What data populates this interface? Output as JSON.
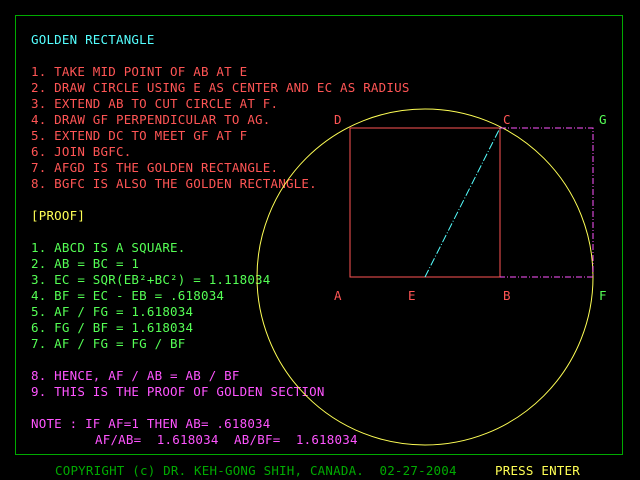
{
  "title": "GOLDEN RECTANGLE",
  "steps": [
    "1. TAKE MID POINT OF AB AT E",
    "2. DRAW CIRCLE USING E AS CENTER AND EC AS RADIUS",
    "3. EXTEND AB TO CUT CIRCLE AT F.",
    "4. DRAW GF PERPENDICULAR TO AG.",
    "5. EXTEND DC TO MEET GF AT F",
    "6. JOIN BGFC.",
    "7. AFGD IS THE GOLDEN RECTANGLE.",
    "8. BGFC IS ALSO THE GOLDEN RECTANGLE."
  ],
  "proof_heading": "[PROOF]",
  "proof_lines": [
    "1. ABCD IS A SQUARE.",
    "2. AB = BC = 1",
    "3. EC = SQR(EB²+BC²) = 1.118034",
    "4. BF = EC - EB = .618034",
    "5. AF / FG = 1.618034",
    "6. FG / BF = 1.618034",
    "7. AF / FG = FG / BF"
  ],
  "conclusion_lines": [
    "8. HENCE, AF / AB = AB / BF",
    "9. THIS IS THE PROOF OF GOLDEN SECTION"
  ],
  "note_line1": "NOTE : IF AF=1 THEN AB= .618034",
  "note_line2": "AF/AB=  1.618034  AB/BF=  1.618034",
  "points": {
    "A": "A",
    "E": "E",
    "B": "B",
    "F": "F",
    "D": "D",
    "C": "C",
    "G": "G"
  },
  "copyright": "COPYRIGHT (c) DR. KEH-GONG SHIH, CANADA.  02-27-2004",
  "press_enter": "PRESS ENTER",
  "colors": {
    "background": "#000000",
    "title": "#55FFFF",
    "steps": "#FF5555",
    "proof_heading": "#FFFF55",
    "proof": "#55FF55",
    "conclusion": "#FF55FF",
    "border": "#00AA00",
    "circle": "#FFFF55",
    "golden_rect": "#FF55FF",
    "diagonal": "#55FFFF"
  }
}
